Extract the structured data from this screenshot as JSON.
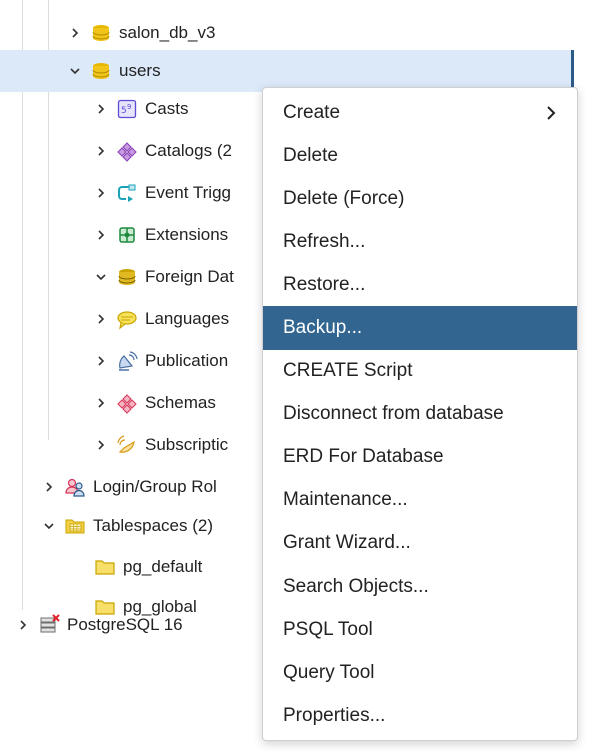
{
  "tree": {
    "items": [
      {
        "label": "salon_db_v3",
        "icon": "database-icon",
        "expanded": false
      },
      {
        "label": "users",
        "icon": "database-icon",
        "expanded": true,
        "selected": true
      },
      {
        "label": "Casts",
        "icon": "casts-icon",
        "expanded": false
      },
      {
        "label": "Catalogs (2",
        "icon": "catalogs-icon",
        "expanded": false
      },
      {
        "label": "Event Trigg",
        "icon": "event-triggers-icon",
        "expanded": false
      },
      {
        "label": "Extensions",
        "icon": "extensions-icon",
        "expanded": false
      },
      {
        "label": "Foreign Dat",
        "icon": "foreign-data-icon",
        "expanded": true
      },
      {
        "label": "Languages",
        "icon": "languages-icon",
        "expanded": false
      },
      {
        "label": "Publication",
        "icon": "publications-icon",
        "expanded": false
      },
      {
        "label": "Schemas",
        "icon": "schemas-icon",
        "expanded": false
      },
      {
        "label": "Subscriptic",
        "icon": "subscriptions-icon",
        "expanded": false
      },
      {
        "label": "Login/Group Rol",
        "icon": "login-roles-icon",
        "expanded": false
      },
      {
        "label": "Tablespaces (2)",
        "icon": "tablespaces-icon",
        "expanded": true
      },
      {
        "label": "pg_default",
        "icon": "folder-icon"
      },
      {
        "label": "pg_global",
        "icon": "folder-icon"
      },
      {
        "label": "PostgreSQL 16",
        "icon": "server-disconnected-icon",
        "expanded": false
      }
    ]
  },
  "context_menu": {
    "items": [
      {
        "label": "Create",
        "submenu": true
      },
      {
        "label": "Delete"
      },
      {
        "label": "Delete (Force)"
      },
      {
        "label": "Refresh..."
      },
      {
        "label": "Restore..."
      },
      {
        "label": "Backup...",
        "active": true
      },
      {
        "label": "CREATE Script"
      },
      {
        "label": "Disconnect from database"
      },
      {
        "label": "ERD For Database"
      },
      {
        "label": "Maintenance..."
      },
      {
        "label": "Grant Wizard..."
      },
      {
        "label": "Search Objects..."
      },
      {
        "label": "PSQL Tool"
      },
      {
        "label": "Query Tool"
      },
      {
        "label": "Properties..."
      }
    ]
  },
  "colors": {
    "selected_row": "#dbe9f9",
    "menu_active": "#326690",
    "database_icon": "#e6b800"
  }
}
